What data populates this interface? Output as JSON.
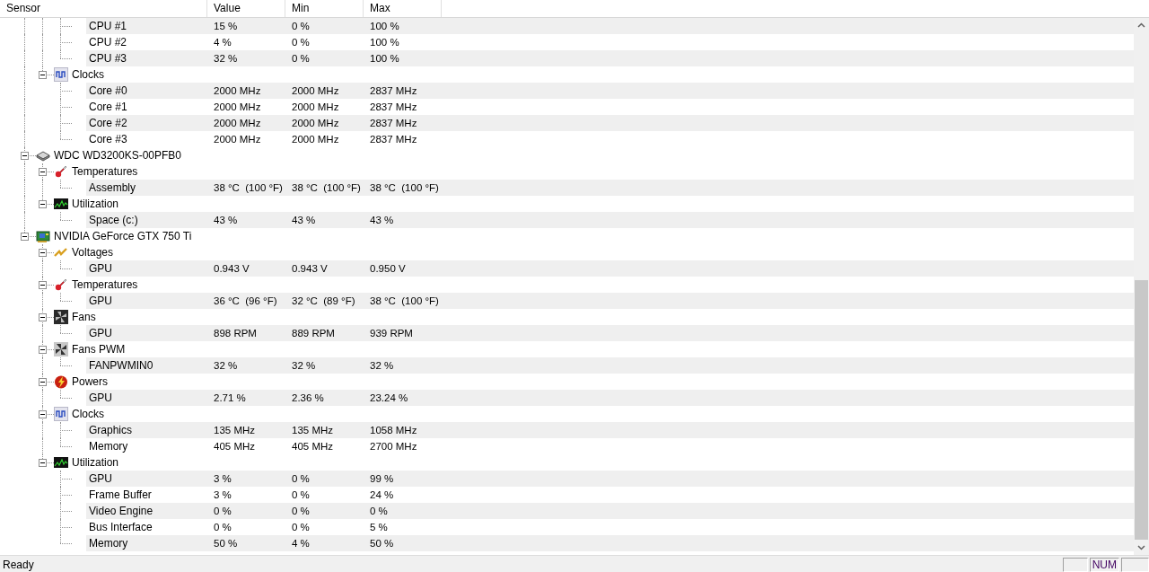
{
  "columns": [
    "Sensor",
    "Value",
    "Min",
    "Max"
  ],
  "tree": [
    {
      "children": [
        {
          "children": [
            {
              "label": "CPU #1",
              "value": "15 %",
              "min": "0 %",
              "max": "100 %"
            },
            {
              "label": "CPU #2",
              "value": "4 %",
              "min": "0 %",
              "max": "100 %"
            },
            {
              "label": "CPU #3",
              "value": "32 %",
              "min": "0 %",
              "max": "100 %"
            }
          ]
        },
        {
          "label": "Clocks",
          "kind": "clocks",
          "expanded": true,
          "children": [
            {
              "label": "Core #0",
              "value": "2000 MHz",
              "min": "2000 MHz",
              "max": "2837 MHz"
            },
            {
              "label": "Core #1",
              "value": "2000 MHz",
              "min": "2000 MHz",
              "max": "2837 MHz"
            },
            {
              "label": "Core #2",
              "value": "2000 MHz",
              "min": "2000 MHz",
              "max": "2837 MHz"
            },
            {
              "label": "Core #3",
              "value": "2000 MHz",
              "min": "2000 MHz",
              "max": "2837 MHz"
            }
          ]
        }
      ]
    },
    {
      "label": "WDC WD3200KS-00PFB0",
      "kind": "drive",
      "expanded": true,
      "children": [
        {
          "label": "Temperatures",
          "kind": "temperatures",
          "expanded": true,
          "children": [
            {
              "label": "Assembly",
              "value": "38 °C  (100 °F)",
              "min": "38 °C  (100 °F)",
              "max": "38 °C  (100 °F)"
            }
          ]
        },
        {
          "label": "Utilization",
          "kind": "utilization",
          "expanded": true,
          "children": [
            {
              "label": "Space (c:)",
              "value": "43 %",
              "min": "43 %",
              "max": "43 %"
            }
          ]
        }
      ]
    },
    {
      "label": "NVIDIA GeForce GTX 750 Ti",
      "kind": "gpu",
      "expanded": true,
      "children": [
        {
          "label": "Voltages",
          "kind": "voltages",
          "expanded": true,
          "children": [
            {
              "label": "GPU",
              "value": "0.943 V",
              "min": "0.943 V",
              "max": "0.950 V"
            }
          ]
        },
        {
          "label": "Temperatures",
          "kind": "temperatures",
          "expanded": true,
          "children": [
            {
              "label": "GPU",
              "value": "36 °C  (96 °F)",
              "min": "32 °C  (89 °F)",
              "max": "38 °C  (100 °F)"
            }
          ]
        },
        {
          "label": "Fans",
          "kind": "fans",
          "expanded": true,
          "children": [
            {
              "label": "GPU",
              "value": "898 RPM",
              "min": "889 RPM",
              "max": "939 RPM"
            }
          ]
        },
        {
          "label": "Fans PWM",
          "kind": "fans_pwm",
          "expanded": true,
          "children": [
            {
              "label": "FANPWMIN0",
              "value": "32 %",
              "min": "32 %",
              "max": "32 %"
            }
          ]
        },
        {
          "label": "Powers",
          "kind": "powers",
          "expanded": true,
          "children": [
            {
              "label": "GPU",
              "value": "2.71 %",
              "min": "2.36 %",
              "max": "23.24 %"
            }
          ]
        },
        {
          "label": "Clocks",
          "kind": "clocks",
          "expanded": true,
          "children": [
            {
              "label": "Graphics",
              "value": "135 MHz",
              "min": "135 MHz",
              "max": "1058 MHz"
            },
            {
              "label": "Memory",
              "value": "405 MHz",
              "min": "405 MHz",
              "max": "2700 MHz"
            }
          ]
        },
        {
          "label": "Utilization",
          "kind": "utilization",
          "expanded": true,
          "children": [
            {
              "label": "GPU",
              "value": "3 %",
              "min": "0 %",
              "max": "99 %"
            },
            {
              "label": "Frame Buffer",
              "value": "3 %",
              "min": "0 %",
              "max": "24 %"
            },
            {
              "label": "Video Engine",
              "value": "0 %",
              "min": "0 %",
              "max": "0 %"
            },
            {
              "label": "Bus Interface",
              "value": "0 %",
              "min": "0 %",
              "max": "5 %"
            },
            {
              "label": "Memory",
              "value": "50 %",
              "min": "4 %",
              "max": "50 %"
            }
          ]
        }
      ]
    }
  ],
  "status_bar": {
    "text": "Ready",
    "panels": [
      {
        "kind": "empty"
      },
      {
        "kind": "text",
        "text": "NUM"
      },
      {
        "kind": "empty"
      }
    ]
  }
}
